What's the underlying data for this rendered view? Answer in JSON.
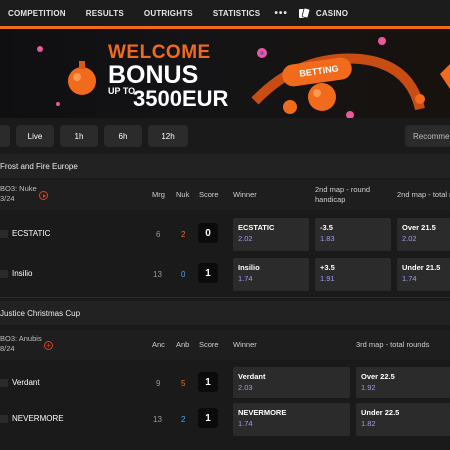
{
  "nav": {
    "items": [
      "COMPETITION",
      "RESULTS",
      "OUTRIGHTS",
      "STATISTICS"
    ],
    "more": "•••",
    "casino": "CASINO"
  },
  "banner": {
    "line1": "WELCOME",
    "line2": "BONUS",
    "line3": "UP TO",
    "line4": "3500EUR",
    "badge": "BETTING"
  },
  "filters": {
    "buttons": [
      "Live",
      "1h",
      "6h",
      "12h"
    ],
    "recommended": "Recomme"
  },
  "tournaments": [
    {
      "name": "Frost and Fire Europe",
      "map_info_1": "BO3: Nuke",
      "map_info_2": "3/24",
      "col_a": "Mrg",
      "col_b": "Nuk",
      "col_score": "Score",
      "col_winner": "Winner",
      "col_mid": "2nd map - round handicap",
      "col_right": "2nd map - total r",
      "rows": [
        {
          "team": "ECSTATIC",
          "a": "6",
          "b": "2",
          "score": "0",
          "winner_label": "ECSTATIC",
          "winner_odd": "2.02",
          "mid_label": "-3.5",
          "mid_odd": "1.83",
          "right_label": "Over 21.5",
          "right_odd": "2.02"
        },
        {
          "team": "Insilio",
          "a": "13",
          "b": "0",
          "score": "1",
          "winner_label": "Insilio",
          "winner_odd": "1.74",
          "mid_label": "+3.5",
          "mid_odd": "1.91",
          "right_label": "Under 21.5",
          "right_odd": "1.74"
        }
      ]
    },
    {
      "name": "Justice Christmas Cup",
      "map_info_1": "BO3: Anubis",
      "map_info_2": "8/24",
      "col_a": "Anc",
      "col_b": "Anb",
      "col_score": "Score",
      "col_winner": "Winner",
      "col_right": "3rd map - total rounds",
      "rows": [
        {
          "team": "Verdant",
          "a": "9",
          "b": "5",
          "score": "1",
          "winner_label": "Verdant",
          "winner_odd": "2.03",
          "right_label": "Over 22.5",
          "right_odd": "1.92"
        },
        {
          "team": "NEVERMORE",
          "a": "13",
          "b": "2",
          "score": "1",
          "winner_label": "NEVERMORE",
          "winner_odd": "1.74",
          "right_label": "Under 22.5",
          "right_odd": "1.82"
        }
      ]
    }
  ],
  "colors": {
    "accent": "#f26b1d",
    "odd_value": "#9a9cf0",
    "icon_red": "#e2431a"
  }
}
